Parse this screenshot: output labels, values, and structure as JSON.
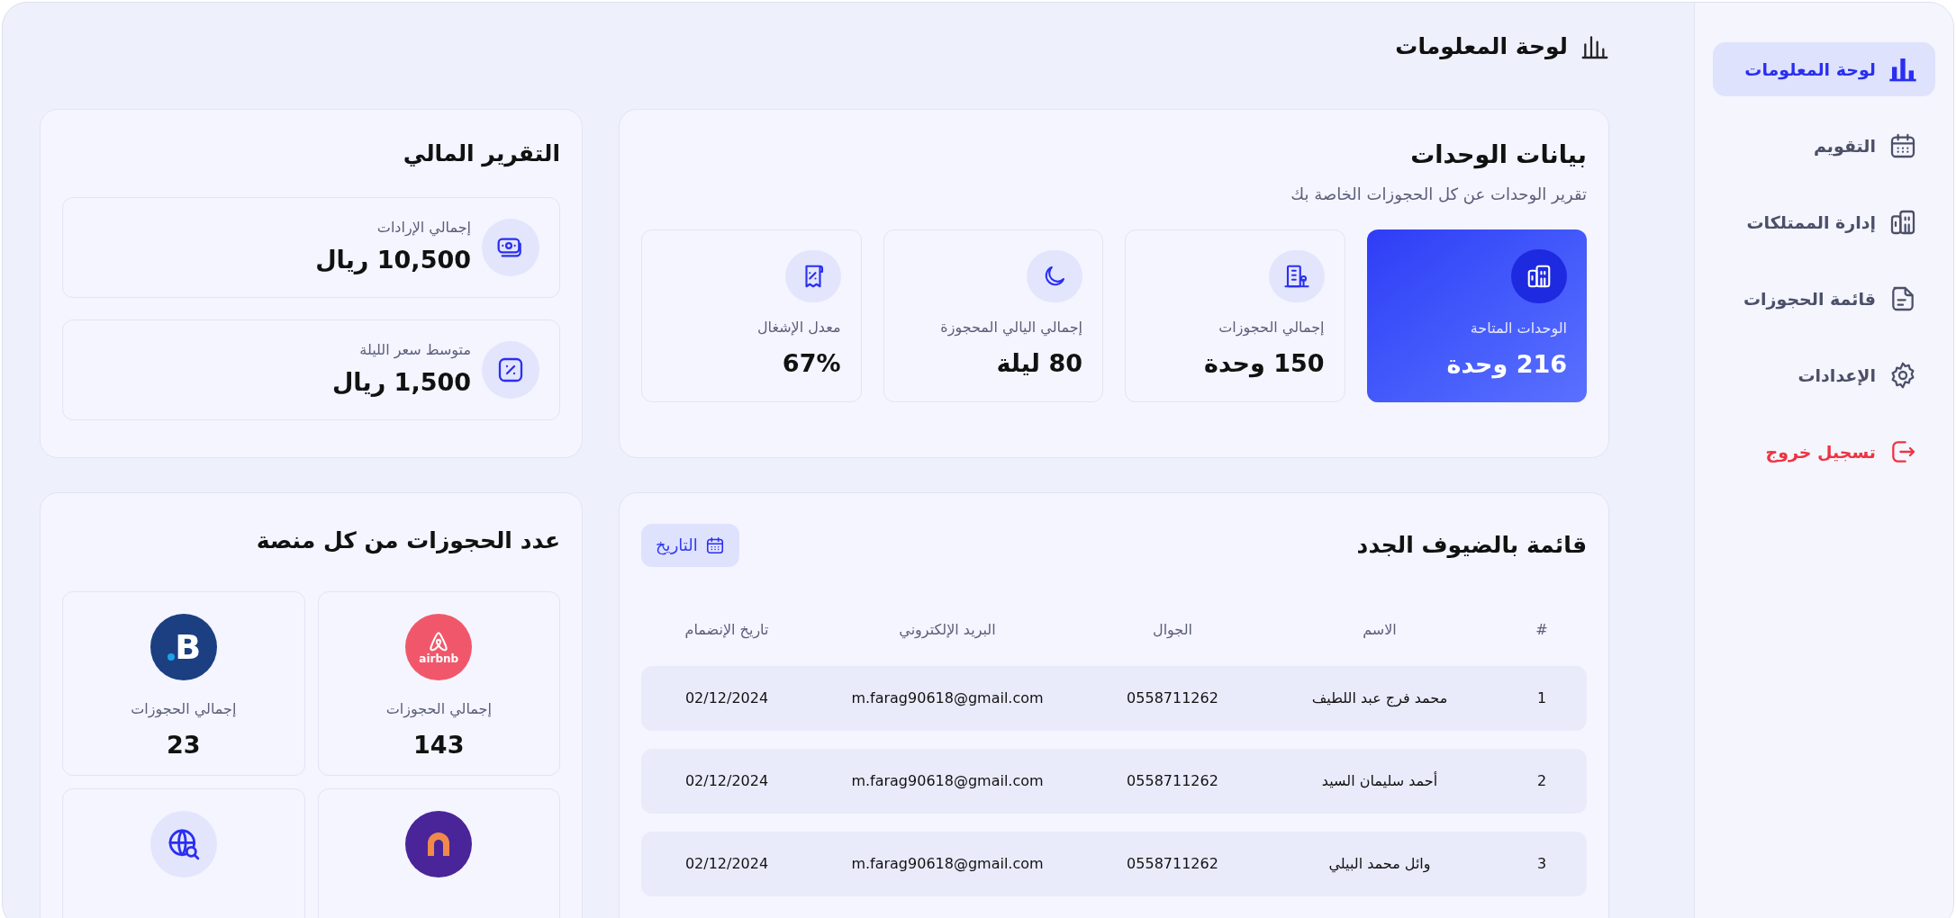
{
  "sidebar": {
    "items": [
      {
        "label": "لوحة المعلومات",
        "selected": true,
        "kind": "nav"
      },
      {
        "label": "التقويم",
        "selected": false,
        "kind": "nav"
      },
      {
        "label": "إدارة الممتلكات",
        "selected": false,
        "kind": "nav"
      },
      {
        "label": "قائمة الحجوزات",
        "selected": false,
        "kind": "nav"
      },
      {
        "label": "الإعدادات",
        "selected": false,
        "kind": "nav"
      },
      {
        "label": "تسجيل خروج",
        "selected": false,
        "kind": "logout"
      }
    ]
  },
  "page_title": "لوحة المعلومات",
  "units": {
    "title": "بيانات الوحدات",
    "subtitle": "تقرير الوحدات عن كل الحجوزات الخاصة بك",
    "stats": [
      {
        "label": "الوحدات المتاحة",
        "value": "216 وحدة",
        "selected": true
      },
      {
        "label": "إجمالي الحجوزات",
        "value": "150 وحدة",
        "selected": false
      },
      {
        "label": "إجمالي اليالي المحجوزة",
        "value": "80 ليلة",
        "selected": false
      },
      {
        "label": "معدل الإشغال",
        "value": "67%",
        "selected": false
      }
    ]
  },
  "financial": {
    "title": "التقرير المالي",
    "items": [
      {
        "label": "إجمالي الإرادات",
        "value": "10,500 ريال"
      },
      {
        "label": "متوسط سعر الليلة",
        "value": "1,500 ريال"
      }
    ]
  },
  "guests": {
    "title": "قائمة بالضيوف الجدد",
    "date_button": "التاريخ",
    "columns": [
      "#",
      "الاسم",
      "الجوال",
      "البريد الإلكتروني",
      "تاريخ الإنضمام"
    ],
    "rows": [
      [
        "1",
        "محمد فرج عبد اللطيف",
        "0558711262",
        "m.farag90618@gmail.com",
        "02/12/2024"
      ],
      [
        "2",
        "أحمد سليمان السيد",
        "0558711262",
        "m.farag90618@gmail.com",
        "02/12/2024"
      ],
      [
        "3",
        "وائل محمد  البيلي",
        "0558711262",
        "m.farag90618@gmail.com",
        "02/12/2024"
      ]
    ]
  },
  "platforms": {
    "title": "عدد الحجوزات من كل منصة",
    "items": [
      {
        "kind": "airbnb",
        "logo_text": "airbnb",
        "label": "إجمالي الحجوزات",
        "value": "143"
      },
      {
        "kind": "booking",
        "logo_text": "B",
        "label": "إجمالي الحجوزات",
        "value": "23"
      },
      {
        "kind": "arch"
      },
      {
        "kind": "globe"
      }
    ]
  }
}
